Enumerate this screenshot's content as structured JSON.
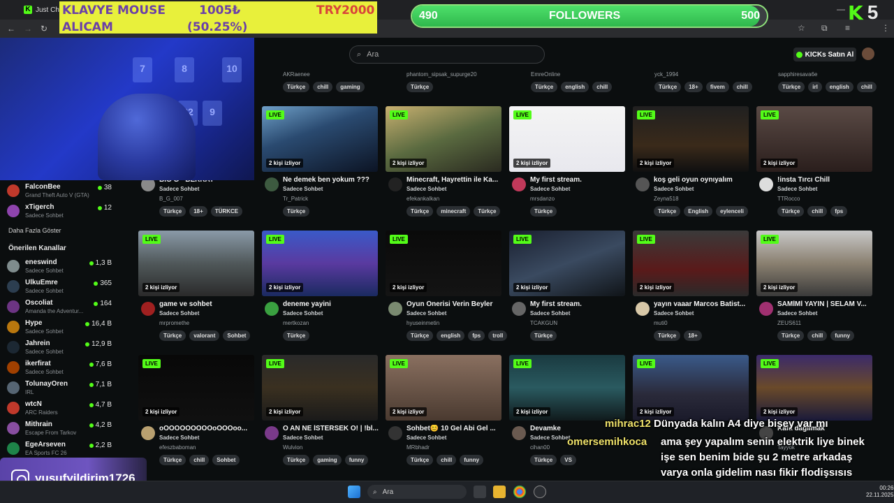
{
  "browser": {
    "tab_label": "Just Chatti",
    "icons": [
      "back-icon",
      "forward-icon",
      "reload-icon",
      "star-icon",
      "extensions-icon",
      "menu-icon"
    ]
  },
  "overlays": {
    "klavye_line1_left": "KLAVYE MOUSE",
    "klavye_line1_mid": "1005₺",
    "klavye_line1_right": "TRY2000",
    "klavye_line2_left": "ALICAM",
    "klavye_line2_mid": "(50.25%)",
    "goal_current": "490",
    "goal_label": "FOLLOWERS",
    "goal_target": "500",
    "goal_progress": 0.98,
    "k5_letter": "K",
    "k5_number": "5",
    "instagram_handle": "yusufyildirim1726",
    "chat": [
      {
        "user": "mihrac12",
        "text": "Dünyada kalın A4 diye bişey var mı"
      },
      {
        "user": "omersemihkoca",
        "text": "ama şey yapalım senin elektrik liye binek işe sen benim bide şu 2 metre arkadaş varya onla gidelim nası fikir flodişsısıs"
      }
    ]
  },
  "header": {
    "search_placeholder": "Ara",
    "kicks_button": "KICKs Satın Al"
  },
  "sidebar": {
    "followed": [
      {
        "name": "FalconBee",
        "game": "Grand Theft Auto V (GTA)",
        "count": "38",
        "color": "#c0392b"
      },
      {
        "name": "xTigerch",
        "game": "Sadece Sohbet",
        "count": "12",
        "color": "#8e44ad"
      }
    ],
    "show_more": "Daha Fazla Göster",
    "recommended_title": "Önerilen Kanallar",
    "recommended": [
      {
        "name": "eneswind",
        "game": "Sadece Sohbet",
        "count": "1,3 B",
        "color": "#7f8c8d"
      },
      {
        "name": "UlkuEmre",
        "game": "Sadece Sohbet",
        "count": "365",
        "color": "#2c3e50"
      },
      {
        "name": "Oscoliat",
        "game": "Amanda the Adventur...",
        "count": "164",
        "color": "#6c3483"
      },
      {
        "name": "Hype",
        "game": "Sadece Sohbet",
        "count": "16,4 B",
        "color": "#b9770e"
      },
      {
        "name": "Jahrein",
        "game": "Sadece Sohbet",
        "count": "12,9 B",
        "color": "#1c2833"
      },
      {
        "name": "ikerfirat",
        "game": "Sadece Sohbet",
        "count": "7,6 B",
        "color": "#a04000"
      },
      {
        "name": "TolunayOren",
        "game": "IRL",
        "count": "7,1 B",
        "color": "#566573"
      },
      {
        "name": "wtcN",
        "game": "ARC Raiders",
        "count": "4,7 B",
        "color": "#c0392b"
      },
      {
        "name": "Mithrain",
        "game": "Escape From Tarkov",
        "count": "4,2 B",
        "color": "#884ea0"
      },
      {
        "name": "EgeArseven",
        "game": "EA Sports FC 26",
        "count": "2,2 B",
        "color": "#1e8449"
      }
    ]
  },
  "top_partial": [
    {
      "user": "AKRaenee",
      "tags": [
        "Türkçe",
        "chill",
        "gaming"
      ]
    },
    {
      "user": "phantom_sipsak_supurge20",
      "tags": [
        "Türkçe"
      ]
    },
    {
      "user": "EmreOnline",
      "tags": [
        "Türkçe",
        "english",
        "chill"
      ]
    },
    {
      "user": "yck_1994",
      "tags": [
        "Türkçe",
        "18+",
        "fivem",
        "chill"
      ]
    },
    {
      "user": "sapphiresava6e",
      "tags": [
        "Türkçe",
        "irl",
        "english",
        "chill"
      ]
    }
  ],
  "live_label": "LIVE",
  "cards": [
    {
      "title": "BIG G - BERKAY",
      "category": "Sadece Sohbet",
      "user": "B_G_007",
      "viewers": "2 kişi izliyor",
      "tags": [
        "Türkçe",
        "18+",
        "TÜRKCE"
      ],
      "avatar": "#8a8a8a",
      "thumb": "linear-gradient(180deg,#2a3a55,#101520)"
    },
    {
      "title": "Ne demek ben yokum ???",
      "category": "Sadece Sohbet",
      "user": "Tr_Patrick",
      "viewers": "2 kişi izliyor",
      "tags": [
        "Türkçe"
      ],
      "avatar": "#3d5a40",
      "thumb": "linear-gradient(160deg,#6fa0c8 0%,#2a4a70 40%,#0c1424 100%)"
    },
    {
      "title": "Minecraft, Hayrettin ile Ka...",
      "category": "Sadece Sohbet",
      "user": "efekankalkan",
      "viewers": "2 kişi izliyor",
      "tags": [
        "Türkçe",
        "minecraft",
        "Türkçe"
      ],
      "avatar": "#222",
      "thumb": "linear-gradient(160deg,#c8b070 0%,#5a6a40 50%,#2a2a20 100%)"
    },
    {
      "title": "My first stream.",
      "category": "Sadece Sohbet",
      "user": "mrsdanzo",
      "viewers": "2 kişi izliyor",
      "tags": [
        "Türkçe"
      ],
      "avatar": "#c0395a",
      "thumb": "linear-gradient(180deg,#f4f4f4 0%,#e8e8ee 100%)"
    },
    {
      "title": "koş geli oyun oynıyalım",
      "category": "Sadece Sohbet",
      "user": "Zeyna518",
      "viewers": "2 kişi izliyor",
      "tags": [
        "Türkçe",
        "English",
        "eylenceli"
      ],
      "avatar": "#555",
      "thumb": "linear-gradient(180deg,#202020 0%,#3a2a1a 60%,#101010 100%)"
    },
    {
      "title": "!insta Tırcı Chill",
      "category": "Sadece Sohbet",
      "user": "TTRocco",
      "viewers": "2 kişi izliyor",
      "tags": [
        "Türkçe",
        "chill",
        "fps"
      ],
      "avatar": "#ddd",
      "thumb": "linear-gradient(180deg,#5a4a45 0%,#2a1e1c 100%)"
    },
    {
      "title": "game ve sohbet",
      "category": "Sadece Sohbet",
      "user": "mrpromethe",
      "viewers": "2 kişi izliyor",
      "tags": [
        "Türkçe",
        "valorant",
        "Sohbet"
      ],
      "avatar": "#a02020",
      "thumb": "linear-gradient(180deg,#8a9aa8 0%,#50585a 50%,#2a2a2a 100%)"
    },
    {
      "title": "deneme yayini",
      "category": "Sadece Sohbet",
      "user": "mertkozan",
      "viewers": "2 kişi izliyor",
      "tags": [
        "Türkçe"
      ],
      "avatar": "#3aa040",
      "thumb": "linear-gradient(180deg,#3a5ac8 0%,#5a3aa0 50%,#1a2a60 100%)"
    },
    {
      "title": "Oyun Önerisi Verin Beyler",
      "category": "Sadece Sohbet",
      "user": "hyuseinmetin",
      "viewers": "2 kişi izliyor",
      "tags": [
        "Türkçe",
        "english",
        "fps",
        "troll"
      ],
      "avatar": "#7a8a70",
      "thumb": "linear-gradient(180deg,#0a0a0a 0%,#141414 100%)"
    },
    {
      "title": "My first stream.",
      "category": "Sadece Sohbet",
      "user": "TCAKGUN",
      "viewers": "2 kişi izliyor",
      "tags": [
        "Türkçe"
      ],
      "avatar": "#666",
      "thumb": "linear-gradient(160deg,#1a2030 0%,#3a4a60 50%,#101418 100%)"
    },
    {
      "title": "yayın vaaar Marcos Batist...",
      "category": "Sadece Sohbet",
      "user": "muti0",
      "viewers": "2 kişi izliyor",
      "tags": [
        "Türkçe",
        "18+"
      ],
      "avatar": "#d8c8a8",
      "thumb": "linear-gradient(180deg,#3a3a3a 0%,#5a1a1a 60%,#2a2a2a 100%)"
    },
    {
      "title": "SAMİMİ YAYIN | SELAM V...",
      "category": "Sadece Sohbet",
      "user": "ZEUS611",
      "viewers": "2 kişi izliyor",
      "tags": [
        "Türkçe",
        "chill",
        "funny"
      ],
      "avatar": "#a03070",
      "thumb": "linear-gradient(180deg,#c8c8c8 0%,#8a8070 50%,#3a3a3a 100%)"
    },
    {
      "title": "oOOOOOOOOOoOOOoo...",
      "category": "Sadece Sohbet",
      "user": "efeszbaboman",
      "viewers": "2 kişi izliyor",
      "tags": [
        "Türkçe",
        "chill",
        "Sohbet"
      ],
      "avatar": "#b8a070",
      "thumb": "linear-gradient(180deg,#080808 0%,#101010 100%)"
    },
    {
      "title": "O AN NE İSTERSEK O! | !bl...",
      "category": "Sadece Sohbet",
      "user": "Wulvion",
      "viewers": "2 kişi izliyor",
      "tags": [
        "Türkçe",
        "gaming",
        "funny"
      ],
      "avatar": "#7a3a8a",
      "thumb": "linear-gradient(180deg,#2a2a2a 0%,#3a3020 50%,#1a1a1a 100%)"
    },
    {
      "title": "Sohbet😊 10 Gel Abi Gel ...",
      "category": "Sadece Sohbet",
      "user": "MRbhadr",
      "viewers": "2 kişi izliyor",
      "tags": [
        "Türkçe",
        "chill",
        "funny"
      ],
      "avatar": "#333",
      "thumb": "linear-gradient(180deg,#8a7060 0%,#4a3a30 100%)"
    },
    {
      "title": "Devamke",
      "category": "Sadece Sohbet",
      "user": "cihan00",
      "viewers": "2 kişi izliyor",
      "tags": [
        "Türkçe",
        "VS"
      ],
      "avatar": "#6a5a50",
      "thumb": "linear-gradient(180deg,#1a3a40 0%,#2a5a60 50%,#101a1c 100%)"
    },
    {
      "title": "",
      "category": "",
      "user": "",
      "viewers": "2 kişi izliyor",
      "tags": [],
      "avatar": "#444",
      "thumb": "linear-gradient(180deg,#3a5a8a 0%,#2a2a3a 60%,#1a1a2a 100%)"
    },
    {
      "title": "Kafa dağılmak",
      "category": "",
      "user": "Tayyok",
      "viewers": "2 kişi izliyor",
      "tags": [],
      "avatar": "#444",
      "thumb": "linear-gradient(180deg,#3a2a6a 0%,#6a4a2a 50%,#1a1a3a 100%)"
    }
  ],
  "taskbar": {
    "search": "Ara",
    "time": "00:26",
    "date": "22.11.2025"
  }
}
